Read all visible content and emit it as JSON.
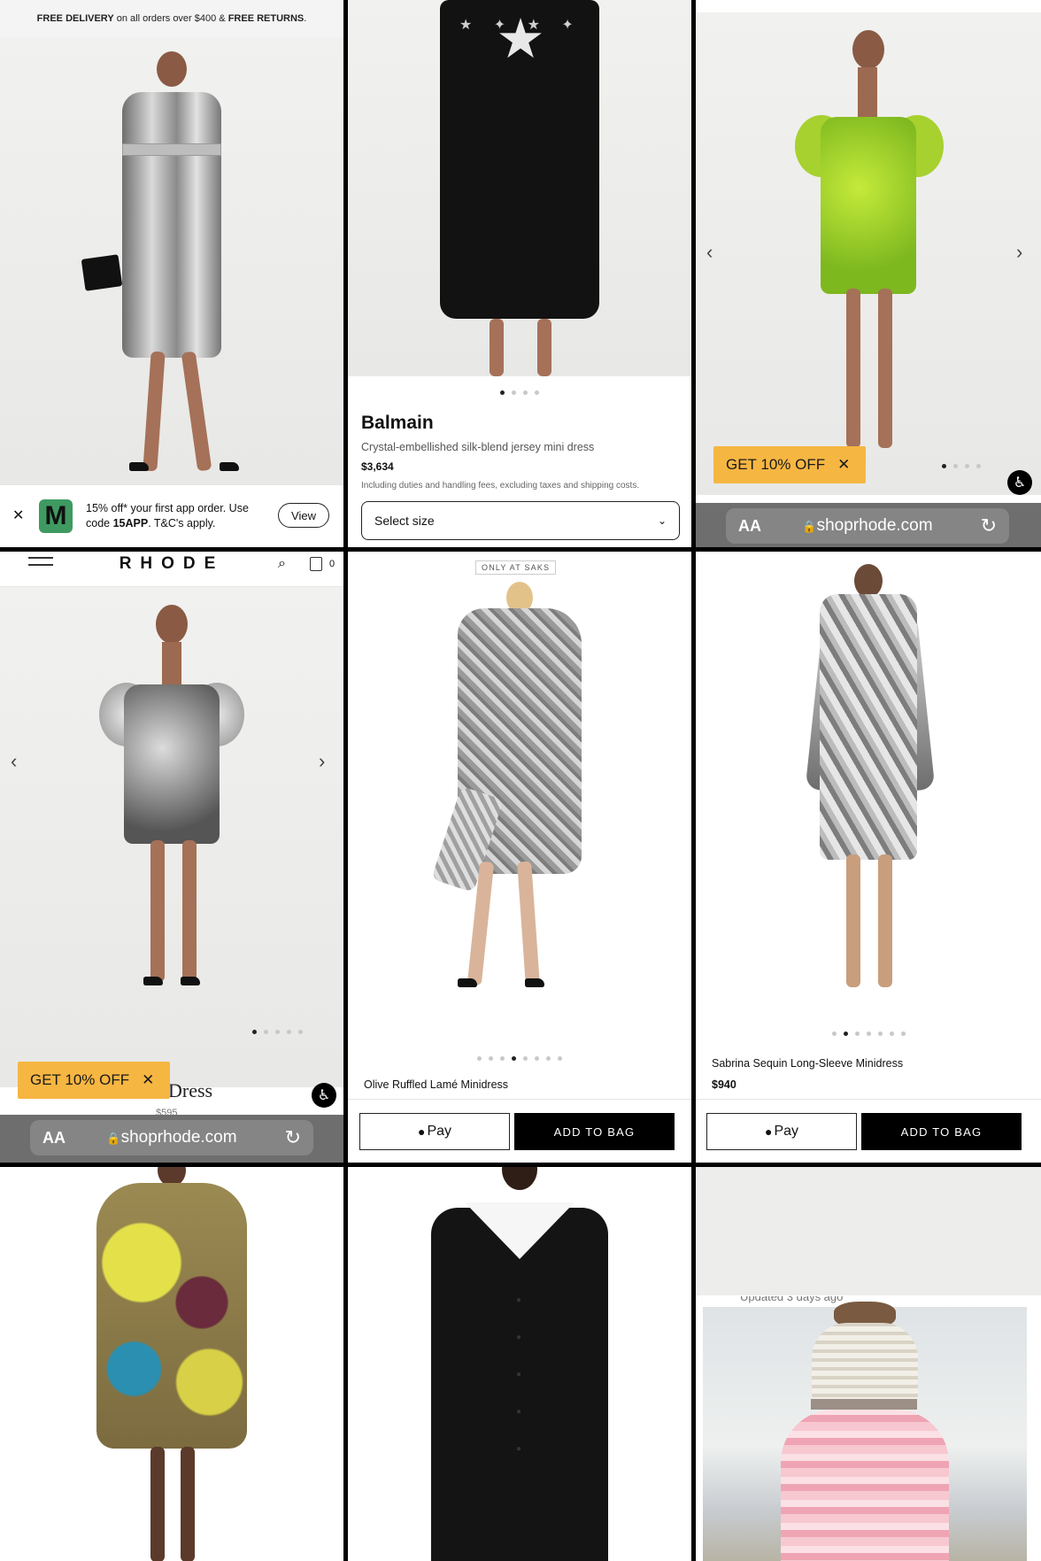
{
  "panel1": {
    "banner_strong1": "FREE DELIVERY",
    "banner_mid": " on all orders over $400 & ",
    "banner_strong2": "FREE RETURNS",
    "banner_end": ".",
    "app_logo": "M",
    "app_text_line1": "15% off* your first app order. Use",
    "app_text_line2a": "code ",
    "app_text_code": "15APP",
    "app_text_line2b": ". T&C's apply.",
    "view_label": "View",
    "close_glyph": "✕"
  },
  "panel2": {
    "brand": "Balmain",
    "product_name": "Crystal-embellished silk-blend jersey mini dress",
    "price": "$3,634",
    "disclaimer": "Including duties and handling fees, excluding taxes and shipping costs.",
    "size_select": "Select size"
  },
  "panel3": {
    "promo_label": "GET 10% OFF",
    "promo_close": "✕",
    "url_aa": "AA",
    "url_host": "shoprhode.com"
  },
  "panel4": {
    "logo": "RHODE",
    "cart_count": "0",
    "promo_label": "GET 10% OFF",
    "promo_close": "✕",
    "title_fragment": "Dress",
    "price_fragment": "$595",
    "url_aa": "AA",
    "url_host": "shoprhode.com"
  },
  "panel5": {
    "badge": "ONLY AT SAKS",
    "product_name": "Olive Ruffled Lamé Minidress",
    "pay_label": "Pay",
    "bag_label": "ADD TO BAG"
  },
  "panel6": {
    "product_name": "Sabrina Sequin Long-Sleeve Minidress",
    "price": "$940",
    "pay_label": "Pay",
    "bag_label": "ADD TO BAG"
  },
  "panel9": {
    "updated_fragment": "Updated 3 days ago"
  },
  "colors": {
    "promo": "#f6b642",
    "app_logo_bg": "#3f9a62",
    "divider": "#000000"
  },
  "icons": [
    "close-icon",
    "chevron-down-icon",
    "chevron-left-icon",
    "chevron-right-icon",
    "accessibility-icon",
    "lock-icon",
    "reload-icon",
    "menu-icon",
    "search-icon",
    "bag-icon",
    "apple-icon"
  ]
}
